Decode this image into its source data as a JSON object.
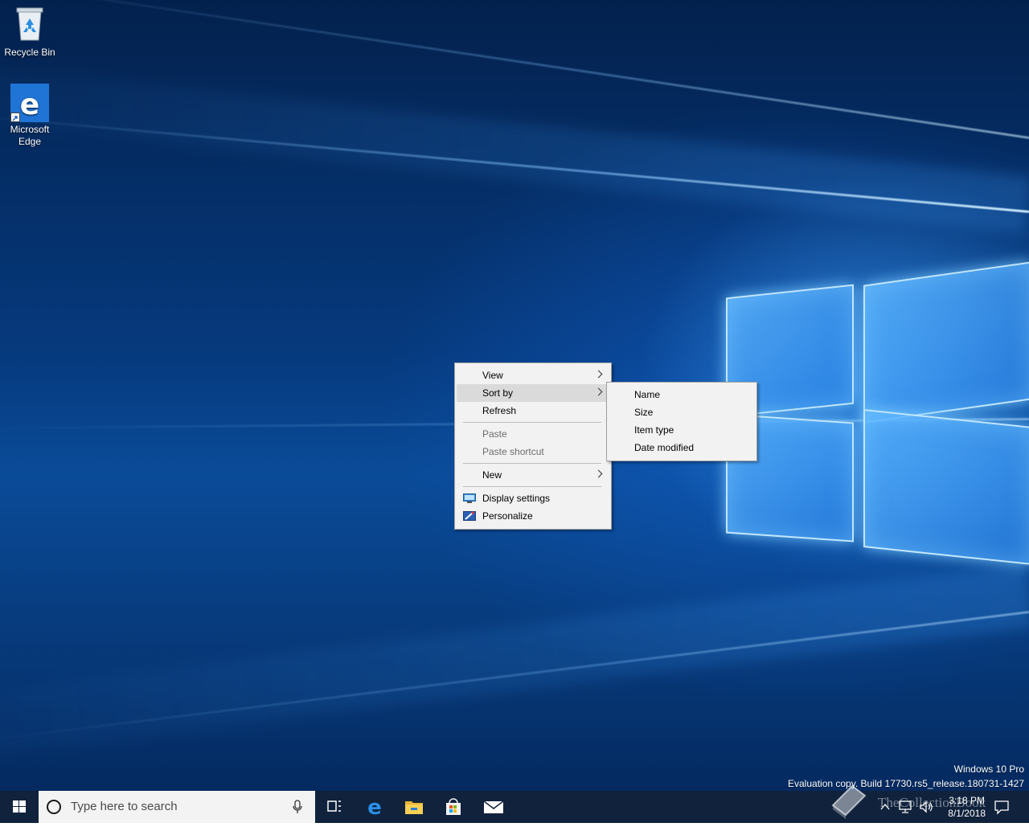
{
  "desktop": {
    "icons": [
      {
        "label": "Recycle Bin",
        "icon": "recycle-bin-icon"
      },
      {
        "label": "Microsoft\nEdge",
        "icon": "edge-icon"
      }
    ],
    "watermark": {
      "line1": "Windows 10 Pro",
      "line2": "Evaluation copy. Build 17730.rs5_release.180731-1427"
    }
  },
  "context_menu": {
    "items": [
      {
        "label": "View",
        "submenu": true,
        "enabled": true
      },
      {
        "label": "Sort by",
        "submenu": true,
        "enabled": true,
        "highlighted": true
      },
      {
        "label": "Refresh",
        "enabled": true
      },
      {
        "label": "Paste",
        "enabled": false
      },
      {
        "label": "Paste shortcut",
        "enabled": false
      },
      {
        "label": "New",
        "submenu": true,
        "enabled": true
      },
      {
        "label": "Display settings",
        "icon": "display-settings-icon",
        "enabled": true
      },
      {
        "label": "Personalize",
        "icon": "personalize-icon",
        "enabled": true
      }
    ]
  },
  "sort_submenu": {
    "items": [
      {
        "label": "Name"
      },
      {
        "label": "Size"
      },
      {
        "label": "Item type"
      },
      {
        "label": "Date modified"
      }
    ]
  },
  "taskbar": {
    "search_placeholder": "Type here to search",
    "pinned": [
      "task-view-icon",
      "edge-icon",
      "file-explorer-icon",
      "store-icon",
      "mail-icon"
    ],
    "tray_icons": [
      "chevron-up-icon",
      "network-icon",
      "volume-icon"
    ],
    "clock_time": "3:18 PM",
    "clock_date": "8/1/2018",
    "overlay_watermark": "TheCollectionBook"
  },
  "colors": {
    "taskbar": "#10223c",
    "menu_bg": "#f2f2f2",
    "menu_highlight": "#dadada",
    "accent": "#0078d7"
  }
}
